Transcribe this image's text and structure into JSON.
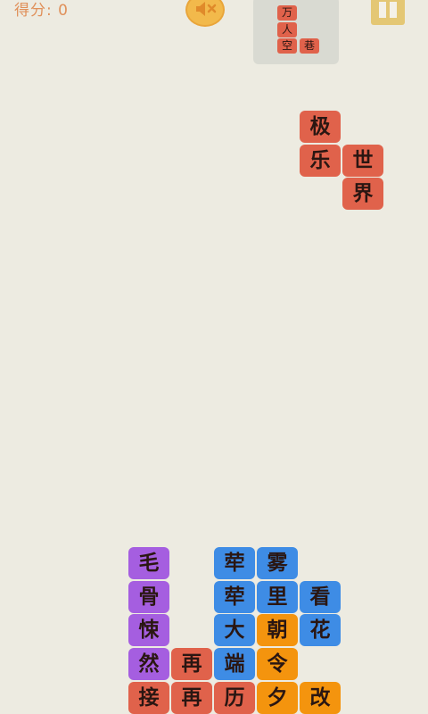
{
  "header": {
    "score_label": "得分:",
    "score_value": "0",
    "sound_icon": "speaker-muted-icon",
    "pause_icon": "pause-icon"
  },
  "colors": {
    "background": "#edebe1",
    "red": "#e0624b",
    "purple": "#a55ee0",
    "blue": "#3e8ce5",
    "orange": "#f4940e"
  },
  "next_piece": {
    "chars": [
      "万",
      "人",
      "空",
      "巷"
    ]
  },
  "falling_piece": {
    "color": "red",
    "chars": [
      "极",
      "乐",
      "世",
      "界"
    ]
  },
  "stack": {
    "purple_column": [
      "毛",
      "骨",
      "悚",
      "然",
      "接"
    ],
    "red_blocks": [
      "再",
      "再",
      "历"
    ],
    "blue_blocks": [
      "荦",
      "雾",
      "荦",
      "里",
      "看",
      "大",
      "花",
      "端"
    ],
    "orange_blocks": [
      "朝",
      "令",
      "夕",
      "改"
    ]
  }
}
